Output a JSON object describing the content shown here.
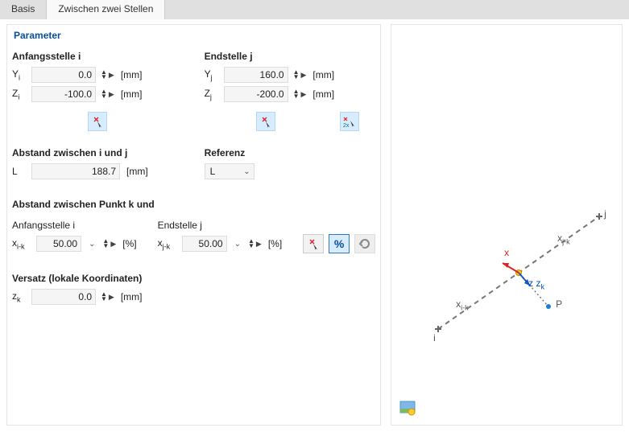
{
  "tabs": {
    "basis": "Basis",
    "between": "Zwischen zwei Stellen"
  },
  "section_title": "Parameter",
  "start": {
    "heading": "Anfangsstelle i",
    "y_label": "Y<sub>i</sub>",
    "y_value": "0.0",
    "z_label": "Z<sub>i</sub>",
    "z_value": "-100.0",
    "unit": "[mm]"
  },
  "end": {
    "heading": "Endstelle j",
    "y_label": "Y<sub>j</sub>",
    "y_value": "160.0",
    "z_label": "Z<sub>j</sub>",
    "z_value": "-200.0",
    "unit": "[mm]"
  },
  "dist": {
    "heading": "Abstand zwischen i und j",
    "label": "L",
    "value": "188.7",
    "unit": "[mm]"
  },
  "ref": {
    "heading": "Referenz",
    "value": "L"
  },
  "distk": {
    "heading": "Abstand zwischen Punkt k und",
    "start_h": "Anfangsstelle i",
    "xi_label": "x<sub>i-k</sub>",
    "xi_value": "50.00",
    "end_h": "Endstelle j",
    "xj_label": "x<sub>j-k</sub>",
    "xj_value": "50.00",
    "unit": "[%]",
    "pct_btn": "%"
  },
  "offset": {
    "heading": "Versatz (lokale Koordinaten)",
    "z_label": "z<sub>k</sub>",
    "z_value": "0.0",
    "unit": "[mm]"
  },
  "diagram_labels": {
    "i": "i",
    "j": "j",
    "x": "x",
    "xjk": "x<sub>j-k</sub>",
    "xik": "x<sub>i-k</sub>",
    "zzk": "z z<sub>k</sub>",
    "P": "P"
  }
}
